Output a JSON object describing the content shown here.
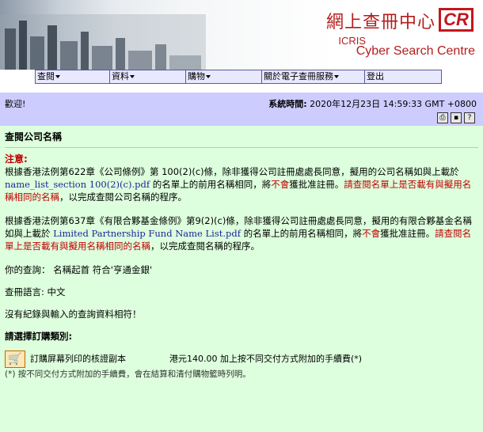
{
  "banner": {
    "title": "網上查冊中心",
    "logo": "CR",
    "icris": "ICRIS",
    "subtitle": "Cyber Search Centre"
  },
  "menu": [
    {
      "label": "查閱",
      "dropdown": true
    },
    {
      "label": "資料",
      "dropdown": true
    },
    {
      "label": "購物",
      "dropdown": true
    },
    {
      "label": "關於電子查冊服務",
      "dropdown": true
    },
    {
      "label": "登出",
      "dropdown": false
    }
  ],
  "welcome": {
    "text": "歡迎!",
    "time_label": "系統時間:",
    "time_value": "2020年12月23日 14:59:33 GMT +0800"
  },
  "toolbar": {
    "print_icon": "printer-icon",
    "save_icon": "disk-icon",
    "help_icon": "help-icon",
    "print_glyph": "⎙",
    "save_glyph": "▪",
    "help_glyph": "?"
  },
  "main": {
    "title": "查閱公司名稱",
    "notice_label": "注意:",
    "p1_a": "根據香港法例第622章《公司條例》第 100(2)(c)條，除非獲得公司註冊處處長同意，擬用的公司名稱如與上載於",
    "p1_link": "name_list_section 100(2)(c).pdf",
    "p1_b": "的名單上的前用名稱相同，將",
    "p1_not": "不會",
    "p1_c": "獲批准註冊。",
    "p1_red": "請查閱名單上是否載有與擬用名稱相同的名稱",
    "p1_d": "，以完成查閱公司名稱的程序。",
    "p2_a": "根據香港法例第637章《有限合夥基金條例》第9(2)(c)條，除非獲得公司註冊處處長同意，擬用的有限合夥基金名稱如與上載於",
    "p2_link": "Limited Partnership Fund Name List.pdf",
    "p2_b": "的名單上的前用名稱相同，將",
    "p2_not": "不會",
    "p2_c": "獲批准註冊。",
    "p2_red": "請查閱名單上是否載有與擬用名稱相同的名稱",
    "p2_d": "，以完成查閱名稱的程序。",
    "query_label": "你的查詢：",
    "query_value": "名稱起首 符合'亨通金銀'",
    "lang_label": "查冊語言:",
    "lang_value": "中文",
    "no_record": "沒有紀錄與輸入的查詢資料相符！",
    "choose_order": "請選擇訂購類別:",
    "order_item": "訂購屏幕列印的核證副本",
    "order_price": "港元140.00 加上按不同交付方式附加的手續費(*)",
    "footnote": "(*) 按不同交付方式附加的手續費，會在結算和清付購物籃時列明。"
  }
}
